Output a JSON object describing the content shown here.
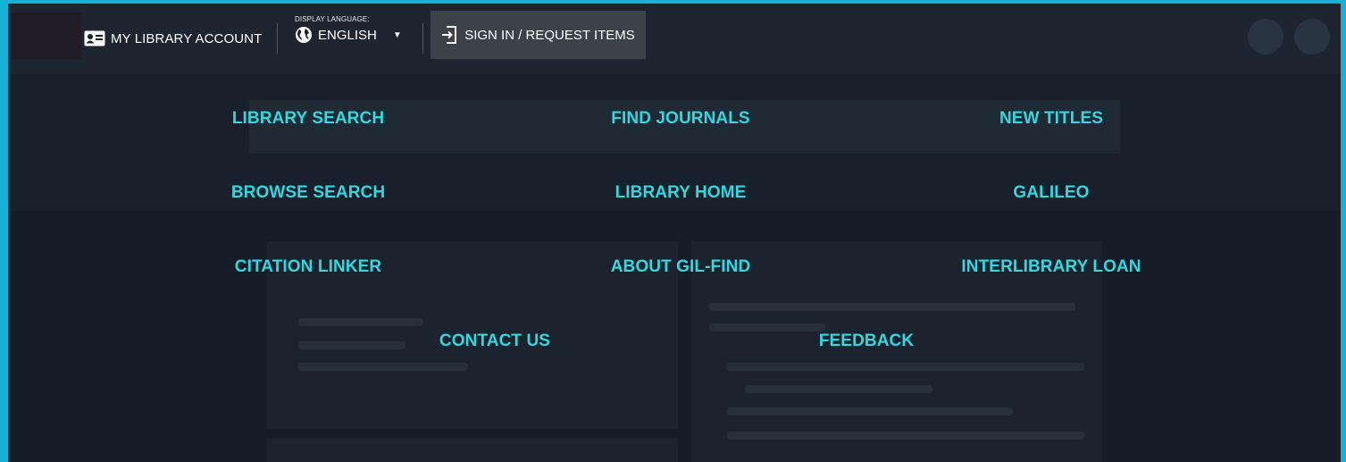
{
  "topbar": {
    "account_label": "MY LIBRARY ACCOUNT",
    "language_caption": "DISPLAY LANGUAGE:",
    "language_value": "ENGLISH",
    "signin_label": "SIGN IN / REQUEST ITEMS",
    "icons": {
      "account": "id-card-icon",
      "language": "globe-icon",
      "caret": "caret-down-icon",
      "signin": "sign-in-icon"
    }
  },
  "menu": {
    "row1": [
      "LIBRARY SEARCH",
      "FIND JOURNALS",
      "NEW TITLES"
    ],
    "row2": [
      "BROWSE SEARCH",
      "LIBRARY HOME",
      "GALILEO"
    ],
    "row3": [
      "CITATION LINKER",
      "ABOUT GIL-FIND",
      "INTERLIBRARY LOAN"
    ],
    "row4": [
      "CONTACT US",
      "FEEDBACK"
    ]
  },
  "colors": {
    "frame": "#1ab0d6",
    "link": "#34d7df",
    "overlay": "#18212b",
    "signin_bg": "#3b4248"
  }
}
